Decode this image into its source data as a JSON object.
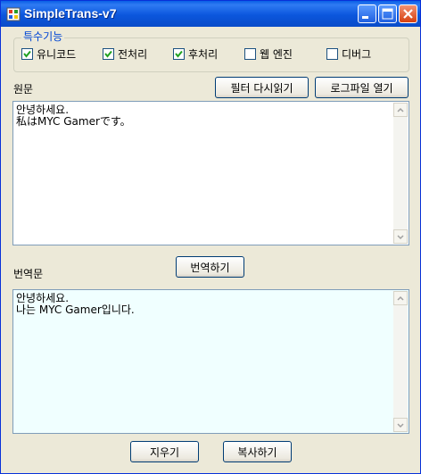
{
  "window": {
    "title": "SimpleTrans-v7"
  },
  "options": {
    "legend": "특수기능",
    "items": [
      {
        "label": "유니코드",
        "checked": true
      },
      {
        "label": "전처리",
        "checked": true
      },
      {
        "label": "후처리",
        "checked": true
      },
      {
        "label": "웹 엔진",
        "checked": false
      },
      {
        "label": "디버그",
        "checked": false
      }
    ]
  },
  "source": {
    "label": "원문",
    "text": "안녕하세요.\n私はMYC Gamerです。"
  },
  "buttons": {
    "reload_filter": "필터 다시읽기",
    "open_log": "로그파일 열기",
    "translate": "번역하기",
    "clear": "지우기",
    "copy": "복사하기"
  },
  "result": {
    "label": "번역문",
    "text": "안녕하세요.\n나는 MYC Gamer입니다."
  },
  "colors": {
    "source_bg": "#ffffff",
    "result_bg": "#f0ffff",
    "accent": "#0046d5"
  }
}
